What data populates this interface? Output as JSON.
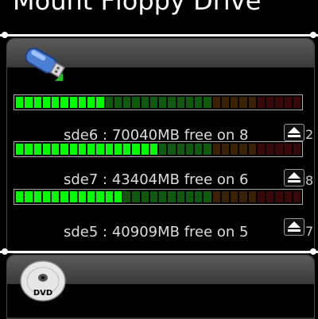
{
  "window": {
    "title": "Mount Floppy Drive"
  },
  "colors": {
    "accent": "#00ff00",
    "segment_green_dim": "#0f5a0f",
    "segment_orange_dim": "#3a2200",
    "segment_red_dim": "#3a0808"
  },
  "drives": [
    {
      "label": "sde6 : 70040MB free on 8",
      "edge_digit": "2",
      "usage_fraction": 0.3
    },
    {
      "label": "sde7 : 43404MB free on 6",
      "edge_digit": "8",
      "usage_fraction": 0.49
    },
    {
      "label": "sde5 : 40909MB free on 5",
      "edge_digit": "7",
      "usage_fraction": 0.36
    }
  ],
  "icons": {
    "usb": "usb-drive-icon",
    "dvd": "dvd-disc-icon",
    "eject": "eject-icon"
  },
  "dvd_label": "DVD"
}
